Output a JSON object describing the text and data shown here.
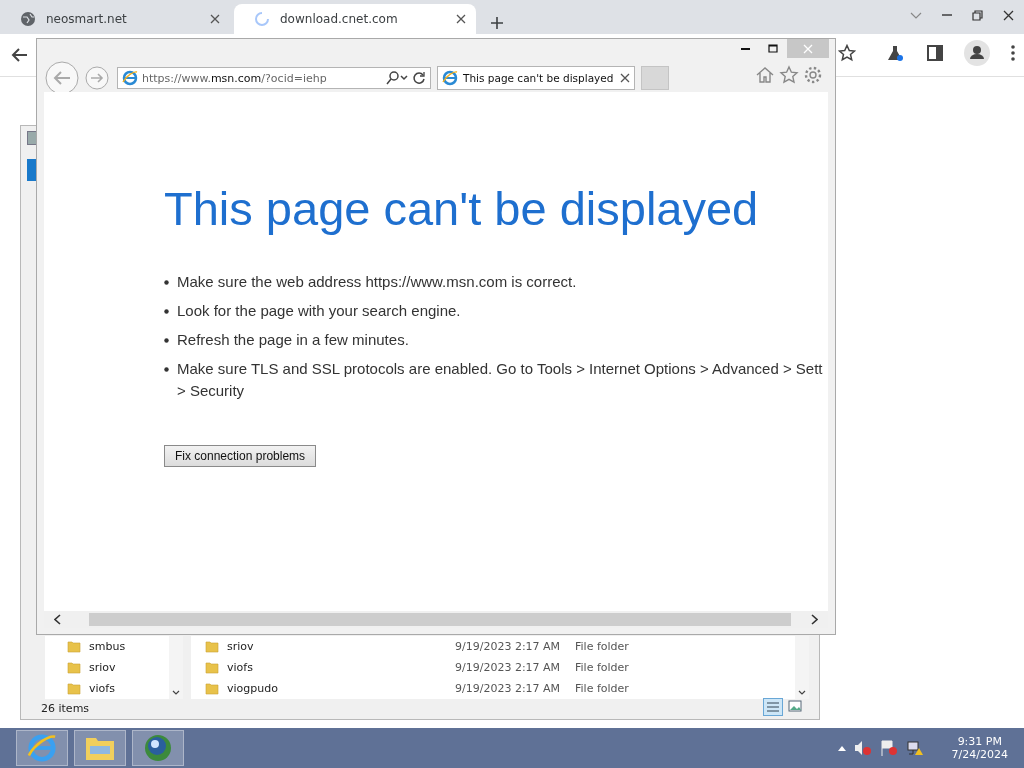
{
  "chrome": {
    "tabs": [
      {
        "title": "neosmart.net",
        "selected": false,
        "loading": false
      },
      {
        "title": "download.cnet.com",
        "selected": true,
        "loading": true
      }
    ]
  },
  "explorer": {
    "tree": [
      "smbus",
      "sriov",
      "viofs"
    ],
    "files": [
      {
        "name": "sriov",
        "date": "9/19/2023 2:17 AM",
        "type": "File folder"
      },
      {
        "name": "viofs",
        "date": "9/19/2023 2:17 AM",
        "type": "File folder"
      },
      {
        "name": "viogpudo",
        "date": "9/19/2023 2:17 AM",
        "type": "File folder"
      }
    ],
    "status": "26 items"
  },
  "ie": {
    "address_prefix": "https://www.",
    "address_domain": "msn.com",
    "address_suffix": "/?ocid=iehp",
    "tab_title": "This page can't be displayed",
    "heading": "This page can't be displayed",
    "bullets": [
      {
        "lines": [
          "Make sure the web address https://www.msn.com is correct."
        ]
      },
      {
        "lines": [
          "Look for the page with your search engine."
        ]
      },
      {
        "lines": [
          "Refresh the page in a few minutes."
        ]
      },
      {
        "lines": [
          "Make sure TLS and SSL protocols are enabled. Go to Tools > Internet Options > Advanced > Sett",
          "> Security"
        ]
      }
    ],
    "button": "Fix connection problems"
  },
  "taskbar": {
    "time": "9:31 PM",
    "date": "7/24/2024"
  }
}
